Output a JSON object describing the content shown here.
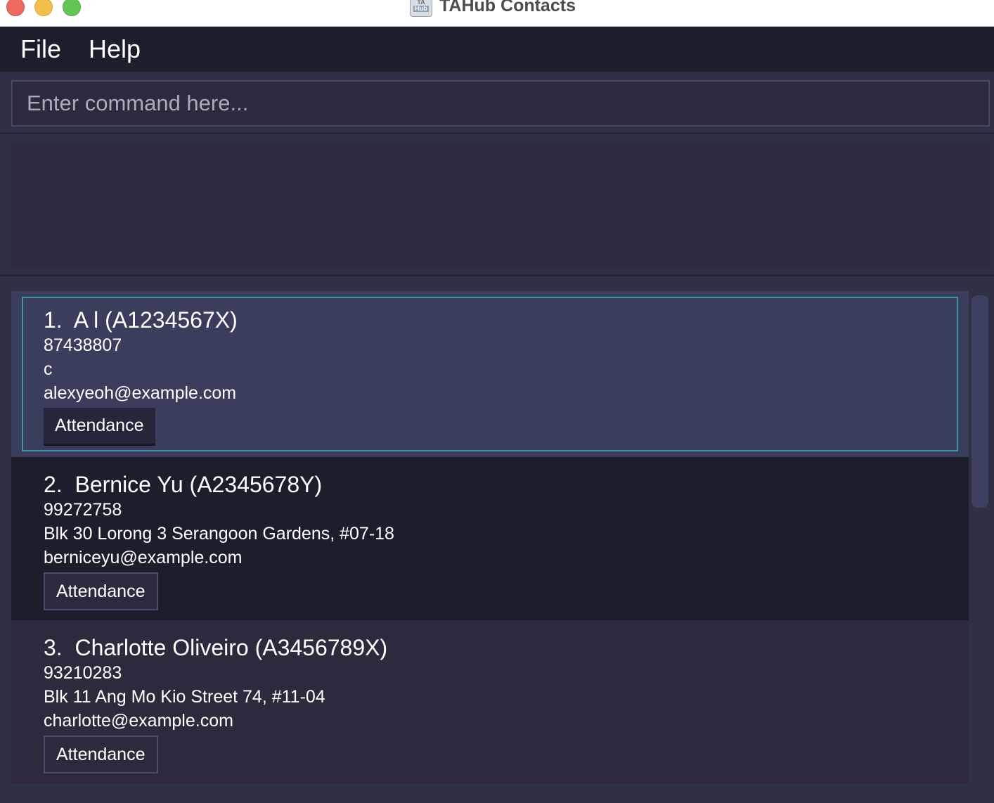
{
  "window": {
    "title": "TAHub Contacts",
    "icon_label_top": "TA",
    "icon_label_mid": "Hub",
    "icon_label_bottom": "CONTACTS"
  },
  "menu": {
    "file_label": "File",
    "help_label": "Help"
  },
  "command": {
    "placeholder": "Enter command here...",
    "value": ""
  },
  "result": {
    "text": ""
  },
  "persons": [
    {
      "index": "1.",
      "name": "A l",
      "matric": "(A1234567X)",
      "phone": "87438807",
      "address": "c",
      "email": "alexyeoh@example.com",
      "button_label": "Attendance"
    },
    {
      "index": "2.",
      "name": "Bernice Yu",
      "matric": "(A2345678Y)",
      "phone": "99272758",
      "address": "Blk 30 Lorong 3 Serangoon Gardens, #07-18",
      "email": "berniceyu@example.com",
      "button_label": "Attendance"
    },
    {
      "index": "3.",
      "name": "Charlotte Oliveiro",
      "matric": "(A3456789X)",
      "phone": "93210283",
      "address": "Blk 11 Ang Mo Kio Street 74, #11-04",
      "email": "charlotte@example.com",
      "button_label": "Attendance"
    }
  ],
  "colors": {
    "menubar_bg": "#1d1e2c",
    "selected_card_bg": "#3b3d5c",
    "selected_border": "#3e91a9",
    "panel_bg": "#2e2a3d"
  }
}
